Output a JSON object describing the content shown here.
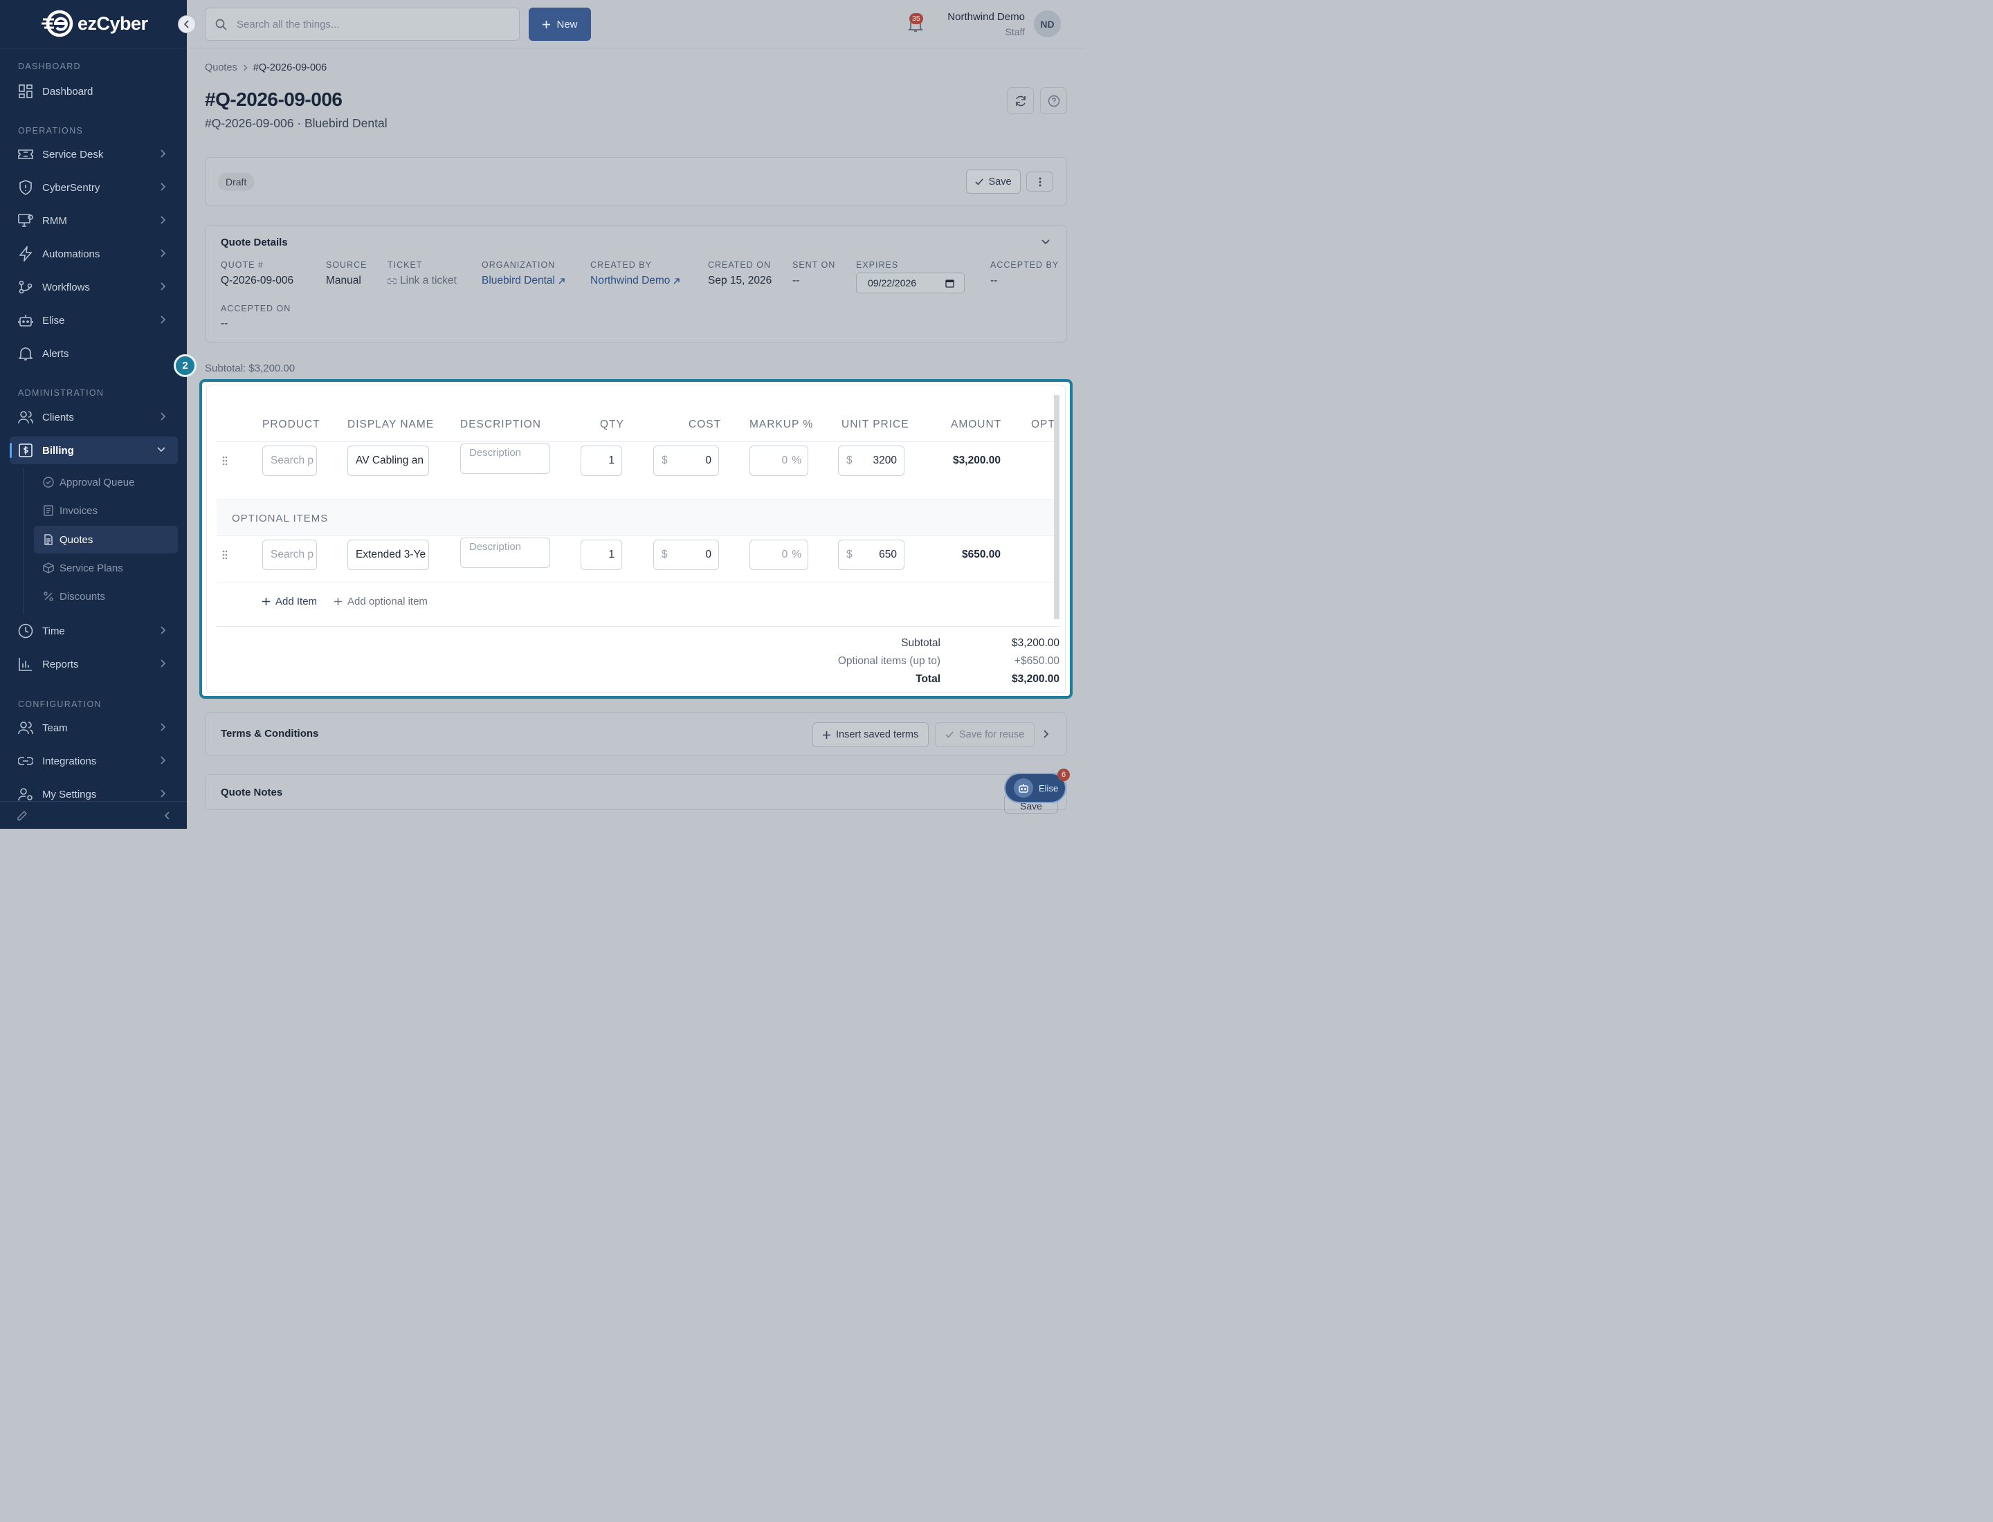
{
  "app": {
    "brand": "ezCyber"
  },
  "sidebar": {
    "sections": {
      "dashboard": "DASHBOARD",
      "operations": "OPERATIONS",
      "administration": "ADMINISTRATION",
      "configuration": "CONFIGURATION"
    },
    "items": {
      "dashboard": "Dashboard",
      "service_desk": "Service Desk",
      "cybersentry": "CyberSentry",
      "rmm": "RMM",
      "automations": "Automations",
      "workflows": "Workflows",
      "elise": "Elise",
      "alerts": "Alerts",
      "clients": "Clients",
      "billing": "Billing",
      "time": "Time",
      "reports": "Reports",
      "team": "Team",
      "integrations": "Integrations",
      "my_settings": "My Settings"
    },
    "billing_sub": {
      "approval_queue": "Approval Queue",
      "invoices": "Invoices",
      "quotes": "Quotes",
      "service_plans": "Service Plans",
      "discounts": "Discounts"
    }
  },
  "topbar": {
    "search_placeholder": "Search all the things...",
    "new_label": "New",
    "notification_count": "35",
    "user_name": "Northwind Demo",
    "user_role": "Staff",
    "avatar_initials": "ND"
  },
  "breadcrumb": {
    "root": "Quotes",
    "current": "#Q-2026-09-006"
  },
  "page": {
    "title": "#Q-2026-09-006",
    "subtitle": "#Q-2026-09-006 · Bluebird Dental"
  },
  "status": {
    "badge": "Draft",
    "save_label": "Save"
  },
  "details": {
    "title": "Quote Details",
    "fields": {
      "quote_num": {
        "label": "QUOTE #",
        "value": "Q-2026-09-006"
      },
      "source": {
        "label": "SOURCE",
        "value": "Manual"
      },
      "ticket": {
        "label": "TICKET",
        "value": "Link a ticket"
      },
      "organization": {
        "label": "ORGANIZATION",
        "value": "Bluebird Dental"
      },
      "created_by": {
        "label": "CREATED BY",
        "value": "Northwind Demo"
      },
      "created_on": {
        "label": "CREATED ON",
        "value": "Sep 15, 2026"
      },
      "sent_on": {
        "label": "SENT ON",
        "value": "--"
      },
      "expires": {
        "label": "EXPIRES",
        "value": "09/22/2026"
      },
      "accepted_by": {
        "label": "ACCEPTED BY",
        "value": "--"
      },
      "accepted_on": {
        "label": "ACCEPTED ON",
        "value": "--"
      }
    }
  },
  "step_badge": "2",
  "subtotal_top": "Subtotal: $3,200.00",
  "items": {
    "columns": {
      "product": "PRODUCT",
      "display_name": "DISPLAY NAME",
      "description": "DESCRIPTION",
      "qty": "QTY",
      "cost": "COST",
      "markup": "MARKUP %",
      "unit_price": "UNIT PRICE",
      "amount": "AMOUNT",
      "optional": "OPTIO"
    },
    "product_placeholder": "Search p",
    "description_placeholder": "Description",
    "currency": "$",
    "percent": "%",
    "optional_header": "OPTIONAL ITEMS",
    "rows": [
      {
        "display_name": "AV Cabling an",
        "qty": "1",
        "cost": "0",
        "markup": "0",
        "unit_price": "3200",
        "amount": "$3,200.00",
        "optional": false
      },
      {
        "display_name": "Extended 3-Ye",
        "qty": "1",
        "cost": "0",
        "markup": "0",
        "unit_price": "650",
        "amount": "$650.00",
        "optional": true
      }
    ],
    "add_item": "Add Item",
    "add_optional": "Add optional item",
    "totals": {
      "subtotal_label": "Subtotal",
      "subtotal": "$3,200.00",
      "optional_label": "Optional items (up to)",
      "optional": "+$650.00",
      "total_label": "Total",
      "total": "$3,200.00"
    }
  },
  "terms": {
    "title": "Terms & Conditions",
    "insert": "Insert saved terms",
    "save_reuse": "Save for reuse"
  },
  "notes": {
    "title": "Quote Notes",
    "save_label": "Save"
  },
  "elise_widget": {
    "label": "Elise",
    "badge": "6"
  }
}
